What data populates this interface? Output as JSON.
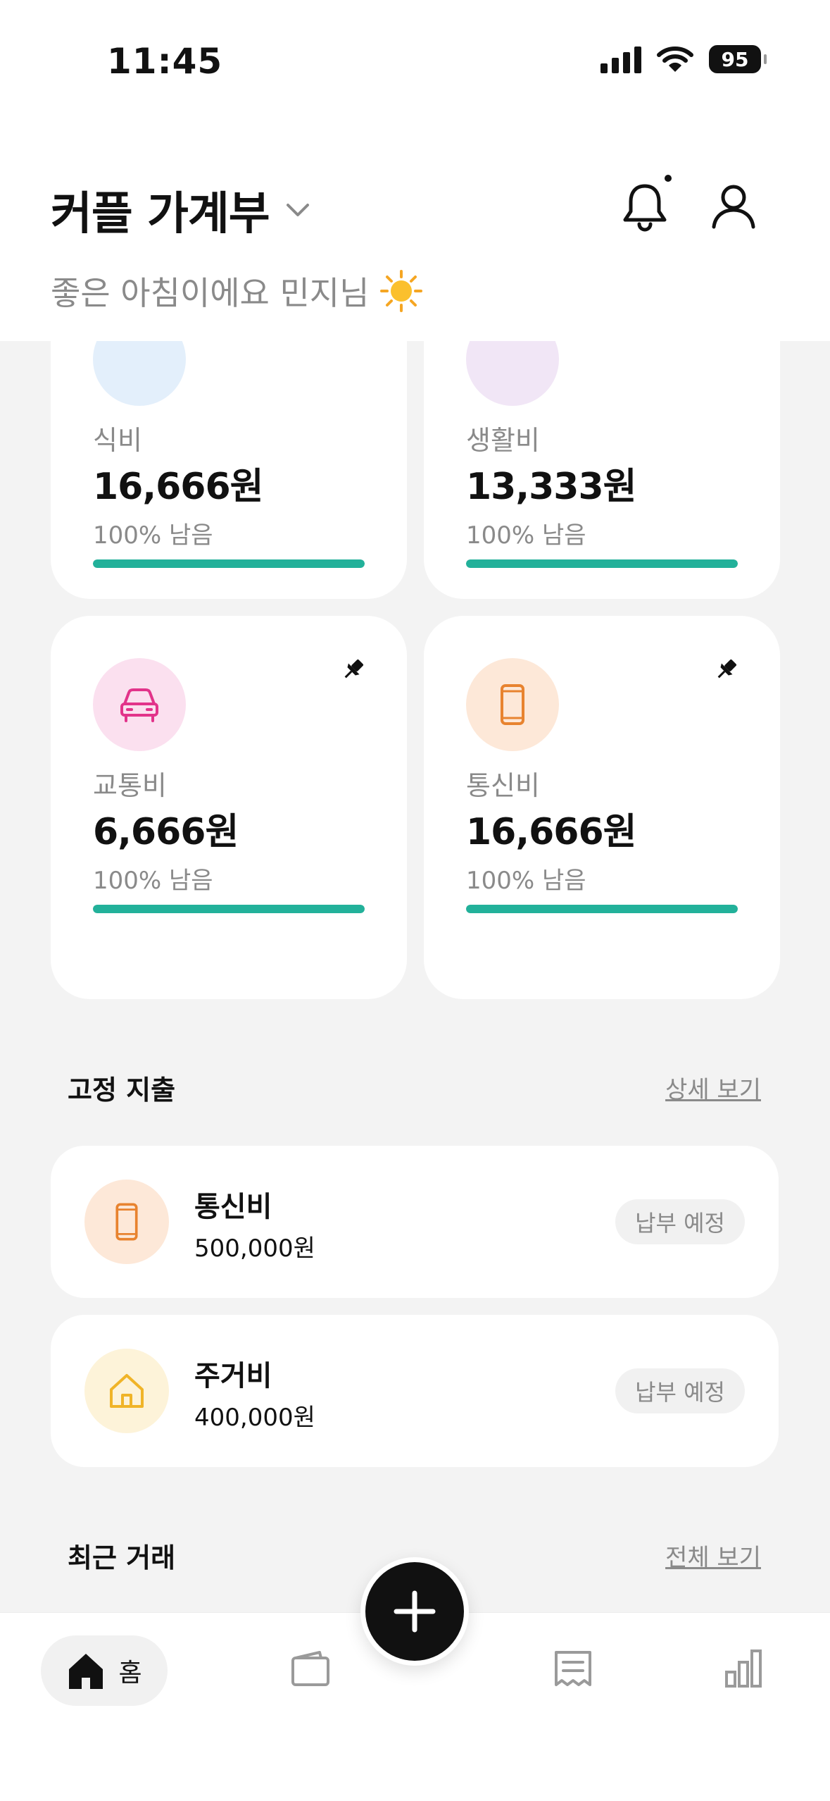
{
  "status": {
    "time": "11:45",
    "battery": "95"
  },
  "header": {
    "title": "커플 가계부",
    "greeting": "좋은 아침이에요 민지님"
  },
  "budget_cards": [
    {
      "name": "식비",
      "amount": "16,666원",
      "remain": "100% 남음",
      "progress": 1.0,
      "icon": "food-icon",
      "icon_bg": "#e3effb"
    },
    {
      "name": "생활비",
      "amount": "13,333원",
      "remain": "100% 남음",
      "progress": 1.0,
      "icon": "living-icon",
      "icon_bg": "#f1e6f6"
    },
    {
      "name": "교통비",
      "amount": "6,666원",
      "remain": "100% 남음",
      "progress": 1.0,
      "icon": "car-icon",
      "icon_bg": "#fbe0ef"
    },
    {
      "name": "통신비",
      "amount": "16,666원",
      "remain": "100% 남음",
      "progress": 1.0,
      "icon": "phone-icon",
      "icon_bg": "#fde8d8"
    }
  ],
  "fixed_expenses": {
    "title": "고정 지출",
    "link": "상세 보기",
    "items": [
      {
        "name": "통신비",
        "amount": "500,000원",
        "badge": "납부 예정",
        "icon": "phone-icon",
        "icon_bg": "#fde8d8"
      },
      {
        "name": "주거비",
        "amount": "400,000원",
        "badge": "납부 예정",
        "icon": "house-icon",
        "icon_bg": "#fdf3d9"
      }
    ]
  },
  "recent": {
    "title": "최근 거래",
    "link": "전체 보기"
  },
  "nav": {
    "home_label": "홈"
  },
  "colors": {
    "accent": "#22b19a",
    "car": "#e2338a",
    "phone": "#e8832f",
    "house": "#f0b428"
  }
}
